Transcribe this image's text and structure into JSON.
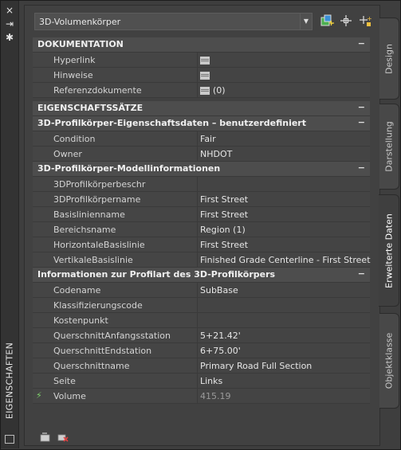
{
  "window": {
    "title": "EIGENSCHAFTEN",
    "buttons": {
      "close": "×",
      "autohide": "⇥",
      "settings": "✱"
    }
  },
  "selector": {
    "value": "3D-Volumenkörper"
  },
  "toolbar": [
    {
      "name": "quick-select-icon"
    },
    {
      "name": "select-objects-icon"
    },
    {
      "name": "pickadd-icon"
    }
  ],
  "sections": {
    "doku": {
      "title": "DOKUMENTATION",
      "toggle": "−",
      "rows": [
        {
          "key": "Hyperlink",
          "value": ""
        },
        {
          "key": "Hinweise",
          "value": ""
        },
        {
          "key": "Referenzdokumente",
          "value": "(0)"
        }
      ]
    },
    "eig": {
      "title": "EIGENSCHAFTSSÄTZE",
      "toggle": "−"
    },
    "profil_eig": {
      "title": "3D-Profilkörper-Eigenschaftsdaten – benutzerdefiniert",
      "toggle": "−",
      "rows": [
        {
          "key": "Condition",
          "value": "Fair"
        },
        {
          "key": "Owner",
          "value": "NHDOT"
        }
      ]
    },
    "modell": {
      "title": "3D-Profilkörper-Modellinformationen",
      "toggle": "−",
      "rows": [
        {
          "key": "3DProfilkörperbeschr",
          "value": ""
        },
        {
          "key": "3DProfilkörpername",
          "value": "First Street"
        },
        {
          "key": "Basislinienname",
          "value": "First Street"
        },
        {
          "key": "Bereichsname",
          "value": "Region (1)"
        },
        {
          "key": "HorizontaleBasislinie",
          "value": "First Street"
        },
        {
          "key": "VertikaleBasislinie",
          "value": "Finished Grade Centerline - First Street"
        }
      ]
    },
    "info": {
      "title": "Informationen zur Profilart des 3D-Profilkörpers",
      "toggle": "−",
      "rows": [
        {
          "key": "Codename",
          "value": "SubBase"
        },
        {
          "key": "Klassifizierungscode",
          "value": ""
        },
        {
          "key": "Kostenpunkt",
          "value": ""
        },
        {
          "key": "QuerschnittAnfangsstation",
          "value": "5+21.42'"
        },
        {
          "key": "QuerschnittEndstation",
          "value": "6+75.00'"
        },
        {
          "key": "Querschnittname",
          "value": "Primary Road Full Section"
        },
        {
          "key": "Seite",
          "value": "Links"
        },
        {
          "key": "Volume",
          "value": "415.19"
        }
      ]
    }
  },
  "tabs": [
    {
      "label": "Design"
    },
    {
      "label": "Darstellung"
    },
    {
      "label": "Erweiterte Daten"
    },
    {
      "label": "Objektklasse"
    }
  ],
  "colors": {
    "bolt": "#7fd36b",
    "panel": "#414141",
    "section": "#4d4d4d"
  }
}
